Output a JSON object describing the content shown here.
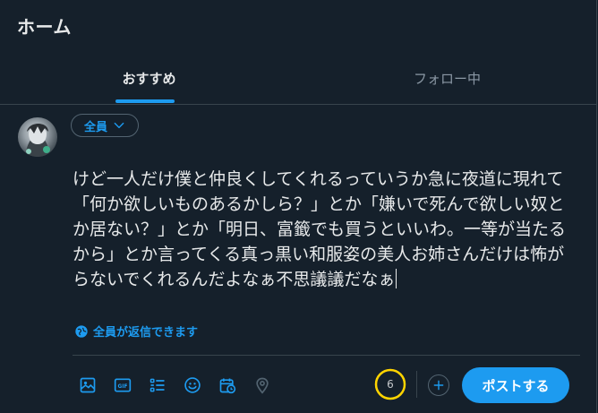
{
  "header": {
    "title": "ホーム"
  },
  "tabs": [
    {
      "label": "おすすめ",
      "active": true
    },
    {
      "label": "フォロー中",
      "active": false
    }
  ],
  "composer": {
    "audience_label": "全員",
    "text": "けど一人だけ僕と仲良くしてくれるっていうか急に夜道に現れて「何か欲しいものあるかしら？」とか「嫌いで死んで欲しい奴とか居ない？」とか「明日、富籤でも買うといいわ。一等が当たるから」とか言ってくる真っ黒い和服姿の美人お姉さんだけは怖がらないでくれるんだよなぁ不思議議だなぁ",
    "reply_setting_label": "全員が返信できます",
    "char_counter": "6",
    "post_label": "ポストする"
  },
  "toolbar": {
    "icons": [
      "image-icon",
      "gif-icon",
      "poll-icon",
      "emoji-icon",
      "schedule-icon",
      "location-icon"
    ]
  },
  "colors": {
    "background": "#15202b",
    "accent": "#1d9bf0",
    "border": "#38444d",
    "counter_ring": "#ffd400",
    "text": "#e7e9ea"
  }
}
